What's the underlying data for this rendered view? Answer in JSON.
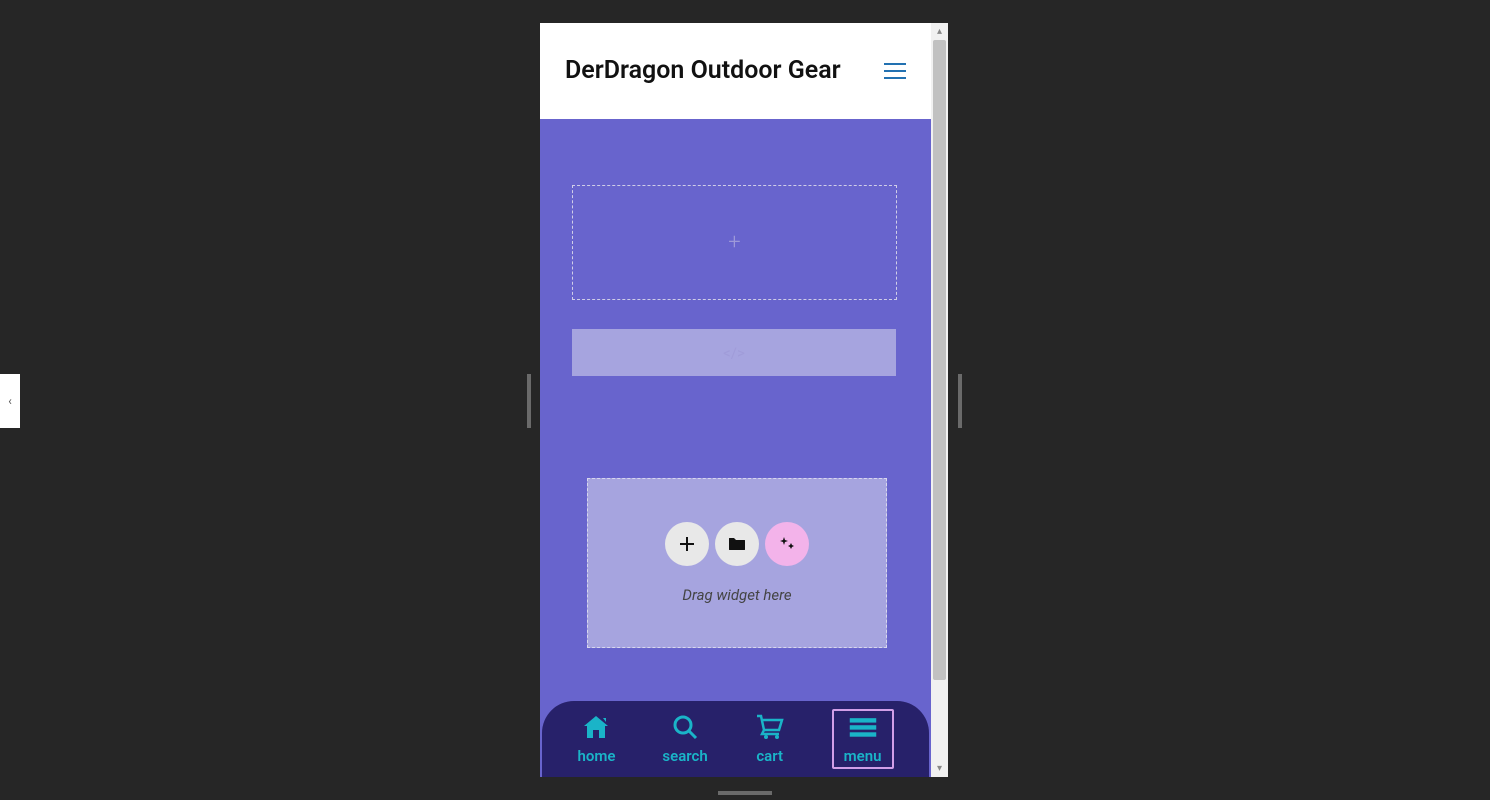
{
  "header": {
    "title": "DerDragon Outdoor Gear"
  },
  "codeBar": {
    "text": "</>"
  },
  "widgetDrop": {
    "hint": "Drag widget here"
  },
  "bottomNav": {
    "items": [
      {
        "label": "home"
      },
      {
        "label": "search"
      },
      {
        "label": "cart"
      },
      {
        "label": "menu"
      }
    ]
  }
}
